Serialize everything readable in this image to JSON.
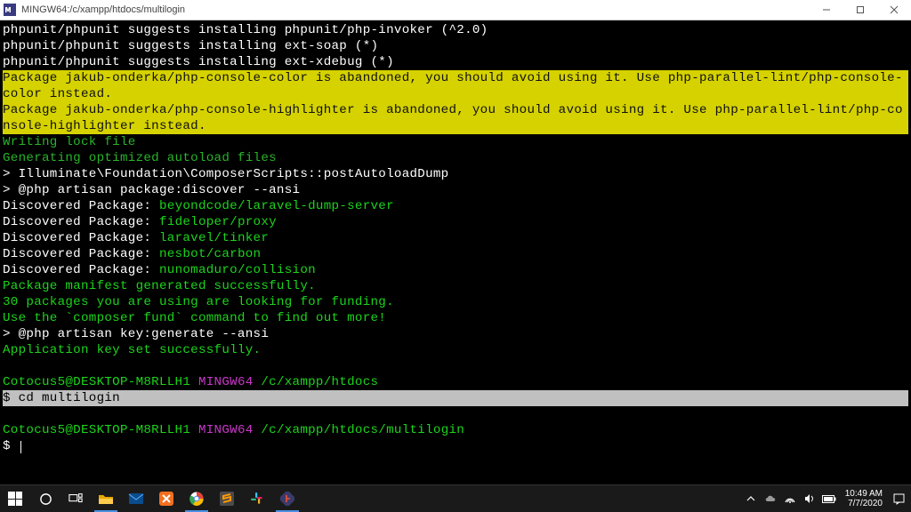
{
  "window": {
    "title": "MINGW64:/c/xampp/htdocs/multilogin"
  },
  "term": {
    "l1": "phpunit/phpunit suggests installing phpunit/php-invoker (^2.0)",
    "l2": "phpunit/phpunit suggests installing ext-soap (*)",
    "l3": "phpunit/phpunit suggests installing ext-xdebug (*)",
    "warn1": "Package jakub-onderka/php-console-color is abandoned, you should avoid using it. Use php-parallel-lint/php-console-color instead.",
    "warn2": "Package jakub-onderka/php-console-highlighter is abandoned, you should avoid using it. Use php-parallel-lint/php-console-highlighter instead.",
    "g1": "Writing lock file",
    "g2": "Generating optimized autoload files",
    "l4": "> Illuminate\\Foundation\\ComposerScripts::postAutoloadDump",
    "l5": "> @php artisan package:discover --ansi",
    "dp_label": "Discovered Package: ",
    "dp1": "beyondcode/laravel-dump-server",
    "dp2": "fideloper/proxy",
    "dp3": "laravel/tinker",
    "dp4": "nesbot/carbon",
    "dp5": "nunomaduro/collision",
    "g3": "Package manifest generated successfully.",
    "g4": "30 packages you are using are looking for funding.",
    "g5": "Use the `composer fund` command to find out more!",
    "l6": "> @php artisan key:generate --ansi",
    "g6": "Application key set successfully.",
    "p_user": "Cotocus5@DESKTOP-M8RLLH1 ",
    "p_env": "MINGW64 ",
    "p_path1": "/c/xampp/htdocs",
    "cmd1": "$ cd multilogin",
    "p_path2": "/c/xampp/htdocs/multilogin",
    "cmd2": "$ "
  },
  "taskbar": {
    "clock_time": "10:49 AM",
    "clock_date": "7/7/2020"
  }
}
